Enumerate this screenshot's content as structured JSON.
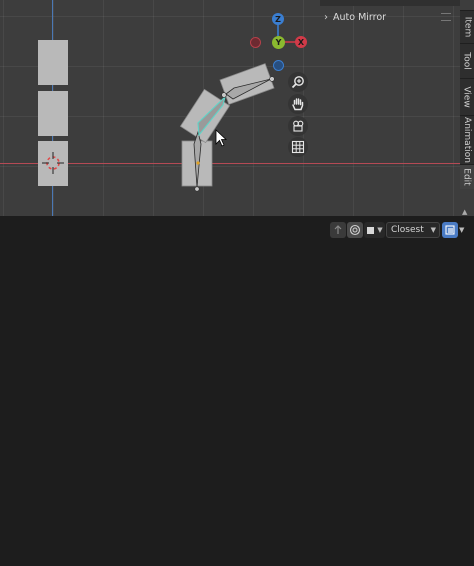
{
  "gizmo": {
    "z_label": "Z",
    "y_label": "Y",
    "x_label": "X",
    "colors": {
      "x": "#d13a48",
      "y": "#8ab92f",
      "z": "#3a7ed1"
    }
  },
  "sidebar": {
    "auto_mirror_label": "Auto Mirror",
    "tabs": [
      "Item",
      "Tool",
      "View",
      "Animation",
      "Edit"
    ],
    "active_tab": "Edit"
  },
  "header": {
    "snap_target_value": "Closest"
  },
  "icons": {
    "zoom": "zoom-in-icon",
    "pan": "hand-icon",
    "camera": "camera-icon",
    "grid": "grid-icon"
  }
}
